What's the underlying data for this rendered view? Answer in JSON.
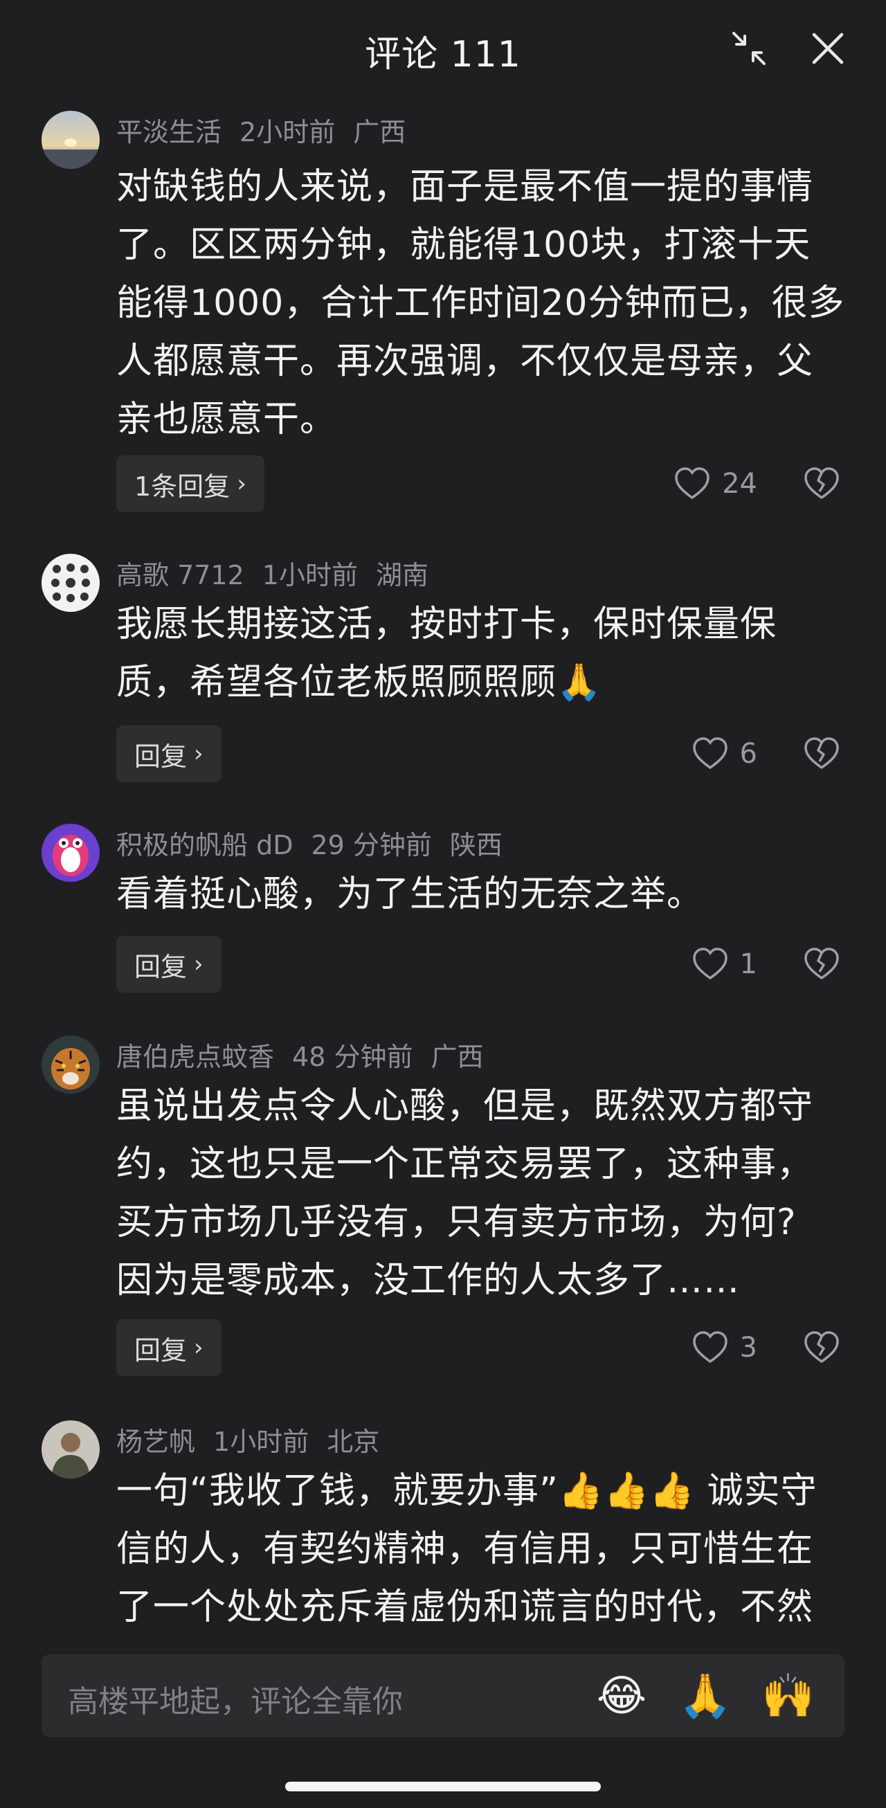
{
  "header": {
    "title": "评论 111"
  },
  "comments": [
    {
      "user": "平淡生活",
      "time": "2小时前",
      "location": "广西",
      "lines": [
        "对缺钱的人来说，面子是最不值一提的事情",
        "了。区区两分钟，就能得100块，打滚十天",
        "能得1000，合计工作时间20分钟而已，很多",
        "人都愿意干。再次强调，不仅仅是母亲，父",
        "亲也愿意干。"
      ],
      "reply_label": "1条回复",
      "likes": "24"
    },
    {
      "user": "高歌 7712",
      "time": "1小时前",
      "location": "湖南",
      "lines": [
        "我愿长期接这活，按时打卡，保时保量保",
        "质，希望各位老板照顾照顾🙏"
      ],
      "reply_label": "回复",
      "likes": "6"
    },
    {
      "user": "积极的帆船 dD",
      "time": "29 分钟前",
      "location": "陕西",
      "lines": [
        "看着挺心酸，为了生活的无奈之举。"
      ],
      "reply_label": "回复",
      "likes": "1"
    },
    {
      "user": "唐伯虎点蚊香",
      "time": "48 分钟前",
      "location": "广西",
      "lines": [
        "虽说出发点令人心酸，但是，既然双方都守",
        "约，这也只是一个正常交易罢了，这种事，",
        "买方市场几乎没有，只有卖方市场，为何?",
        "因为是零成本，没工作的人太多了……"
      ],
      "reply_label": "回复",
      "likes": "3"
    },
    {
      "user": "杨艺帆",
      "time": "1小时前",
      "location": "北京",
      "lines": [
        "一句“我收了钱，就要办事”👍👍👍 诚实守",
        "信的人，有契约精神，有信用，只可惜生在",
        "了一个处处充斥着虚伪和谎言的时代，不然"
      ]
    }
  ],
  "input": {
    "placeholder": "高楼平地起，评论全靠你",
    "quick_emojis": [
      "😂",
      "🙏",
      "🙌"
    ]
  },
  "icons": {
    "collapse": "collapse-arrows-icon",
    "close": "close-icon",
    "like": "heart-outline-icon",
    "dislike": "broken-heart-icon"
  }
}
